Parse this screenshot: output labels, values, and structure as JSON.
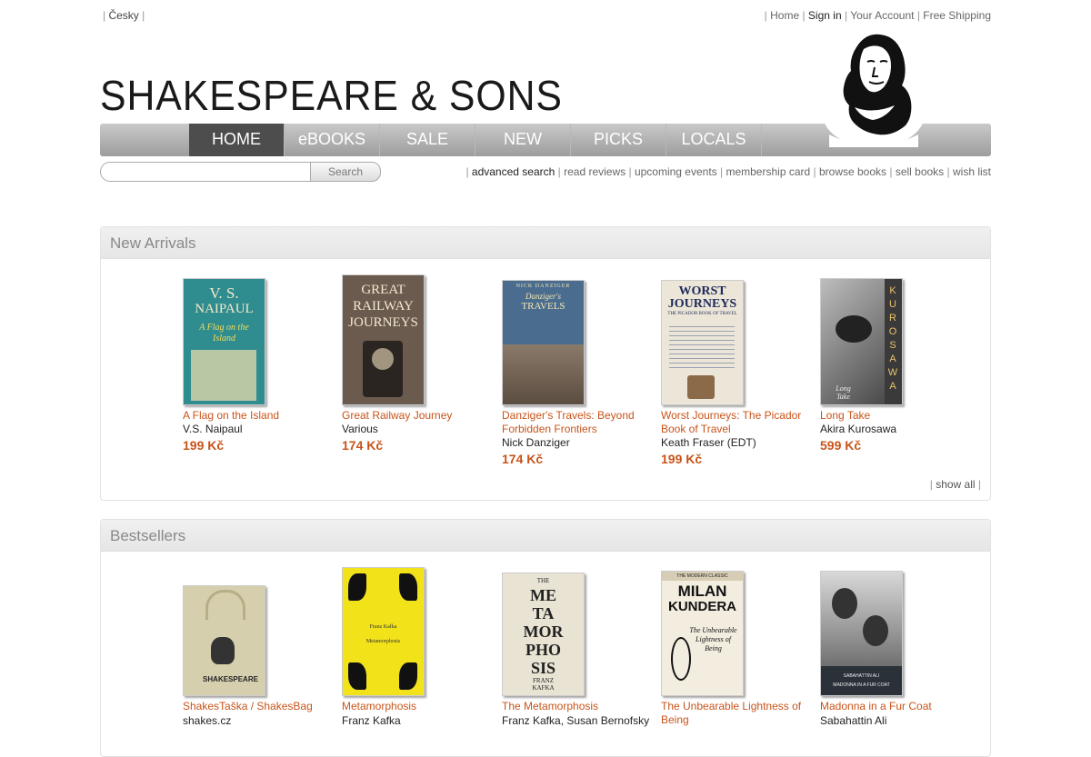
{
  "top_bar": {
    "language": "Česky",
    "links": [
      "Home",
      "Sign in",
      "Your Account",
      "Free Shipping"
    ]
  },
  "logo_text": "SHAKESPEARE & SONS",
  "nav": {
    "items": [
      "HOME",
      "eBOOKS",
      "SALE",
      "NEW",
      "PICKS",
      "LOCALS"
    ],
    "active": "HOME"
  },
  "search": {
    "value": "",
    "placeholder": "",
    "button_label": "Search"
  },
  "sub_links": [
    "advanced search",
    "read reviews",
    "upcoming events",
    "membership card",
    "browse books",
    "sell books",
    "wish list"
  ],
  "new_arrivals": {
    "title": "New Arrivals",
    "show_all": "show all",
    "books": [
      {
        "title": "A Flag on the Island",
        "author": "V.S. Naipaul",
        "price": "199 Kč",
        "cover_lines": [
          "V. S.",
          "NAIPAUL",
          "A Flag on the",
          "Island"
        ],
        "cover_color": "#2f8c8f"
      },
      {
        "title": "Great Railway Journey",
        "author": "Various",
        "price": "174 Kč",
        "cover_lines": [
          "GREAT",
          "RAILWAY",
          "JOURNEYS"
        ],
        "cover_color": "#6b5a4e"
      },
      {
        "title": "Danziger's Travels: Beyond Forbidden Frontiers",
        "author": "Nick Danziger",
        "price": "174 Kč",
        "cover_lines": [
          "NICK DANZIGER",
          "Danziger's",
          "TRAVELS"
        ],
        "cover_color": "#4a6d8f"
      },
      {
        "title": "Worst Journeys: The Picador Book of Travel",
        "author": "Keath Fraser (EDT)",
        "price": "199 Kč",
        "cover_lines": [
          "WORST",
          "JOURNEYS",
          "THE PICADOR BOOK OF TRAVEL"
        ],
        "cover_color": "#ece6d8"
      },
      {
        "title": "Long Take",
        "author": "Akira Kurosawa",
        "price": "599 Kč",
        "cover_lines": [
          "KUROSAWA",
          "Long",
          "Take"
        ],
        "cover_color": "#3a3a3a"
      }
    ]
  },
  "bestsellers": {
    "title": "Bestsellers",
    "books": [
      {
        "title": "ShakesTaška / ShakesBag",
        "author": "shakes.cz",
        "cover_lines": [
          "SHAKESPEARE"
        ],
        "cover_color": "#d6cfae"
      },
      {
        "title": "Metamorphosis",
        "author": "Franz Kafka",
        "cover_lines": [
          "Franz Kafka",
          "Metamorphosis"
        ],
        "cover_color": "#f2e21a"
      },
      {
        "title": "The Metamorphosis",
        "author": "Franz Kafka, Susan Bernofsky",
        "cover_lines": [
          "THE",
          "ME",
          "TA",
          "MOR",
          "PHO",
          "SIS",
          "FRANZ",
          "KAFKA"
        ],
        "cover_color": "#e9e3d3"
      },
      {
        "title": "The Unbearable Lightness of Being",
        "author": "",
        "cover_lines": [
          "THE MODERN CLASSIC",
          "MILAN",
          "KUNDERA",
          "The Unbearable Lightness of Being"
        ],
        "cover_color": "#f3ede0"
      },
      {
        "title": "Madonna in a Fur Coat",
        "author": "Sabahattin Ali",
        "cover_lines": [
          "SABAHATTIN ALI",
          "MADONNA IN A FUR COAT"
        ],
        "cover_color": "#2a3138"
      }
    ]
  }
}
